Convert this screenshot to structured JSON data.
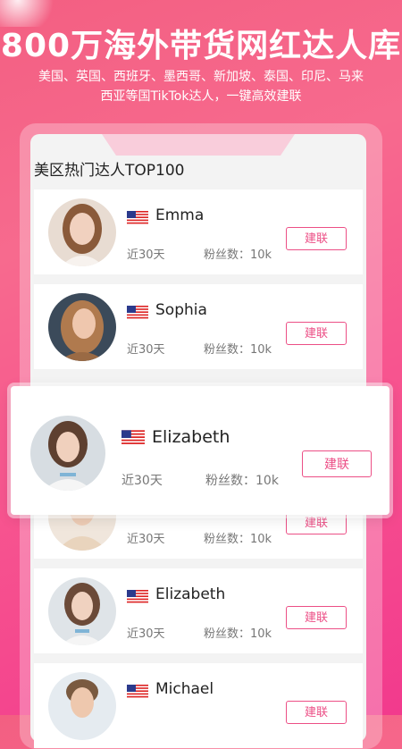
{
  "header": {
    "title": "800万海外带货网红达人库",
    "subtitle_line1": "美国、英国、西班牙、墨西哥、新加坡、泰国、印尼、马来",
    "subtitle_line2": "西亚等国TikTok达人，一键高效建联"
  },
  "list": {
    "title": "美区热门达人TOP100",
    "period_label": "近30天",
    "fans_label": "粉丝数：10k",
    "connect_label": "建联",
    "items": [
      {
        "name": "Emma"
      },
      {
        "name": "Sophia"
      },
      {
        "name": ""
      },
      {
        "name": "Elizabeth"
      },
      {
        "name": "Michael"
      }
    ]
  },
  "featured": {
    "name": "Elizabeth",
    "period_label": "近30天",
    "fans_label": "粉丝数：10k",
    "connect_label": "建联"
  },
  "colors": {
    "accent": "#ec4f86",
    "background_top": "#f35f82",
    "background_bottom": "#f23a8d"
  }
}
